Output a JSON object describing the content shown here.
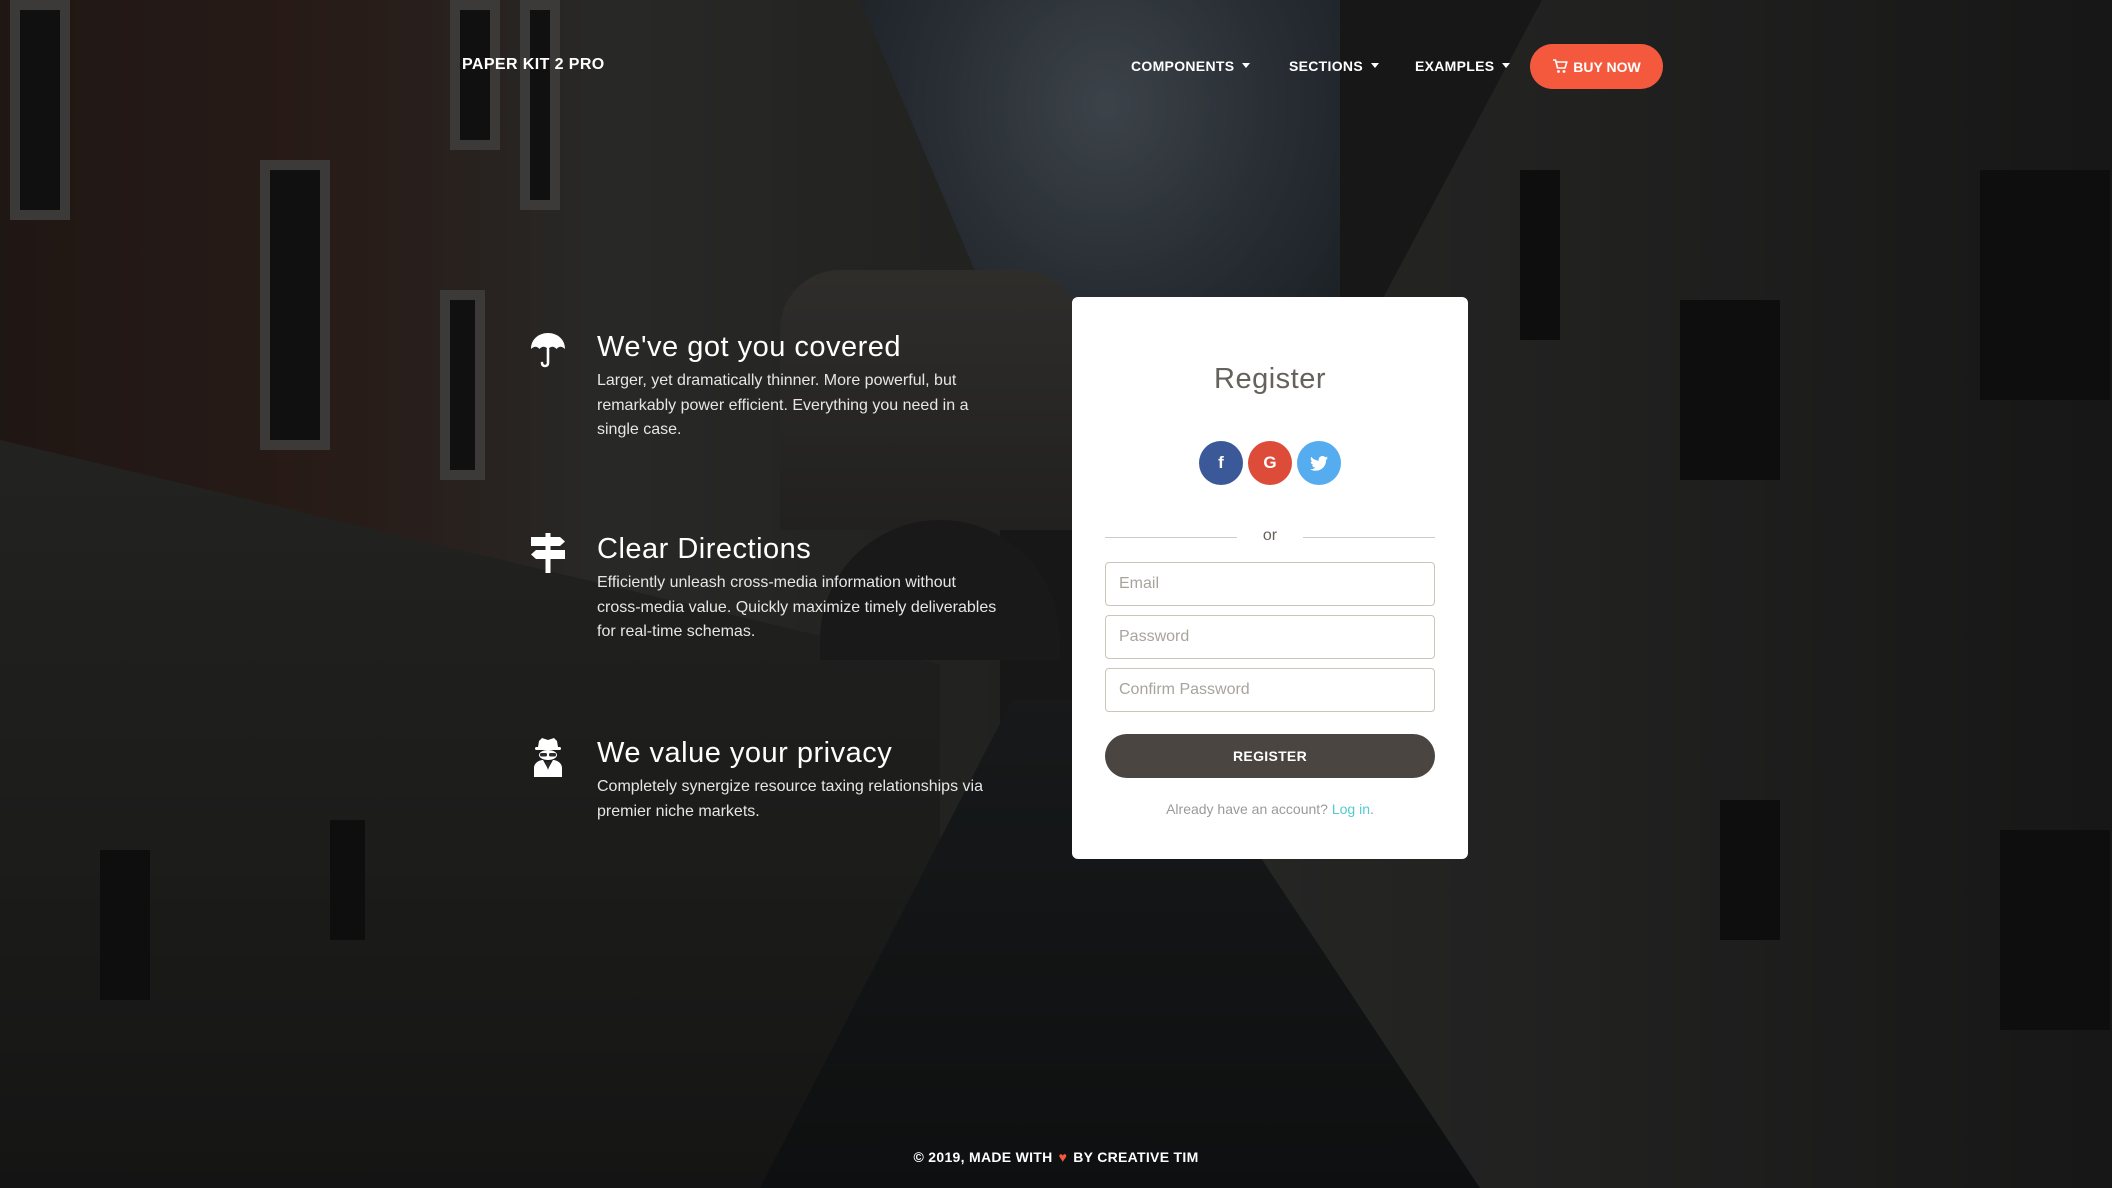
{
  "nav": {
    "brand": "PAPER KIT 2 PRO",
    "items": [
      {
        "label": "COMPONENTS"
      },
      {
        "label": "SECTIONS"
      },
      {
        "label": "EXAMPLES"
      }
    ],
    "buy_label": "BUY NOW",
    "buy_icon": "cart-icon",
    "buy_color": "#f5593d"
  },
  "features": [
    {
      "icon": "umbrella-icon",
      "title": "We've got you covered",
      "text": "Larger, yet dramatically thinner. More powerful, but remarkably power efficient. Everything you need in a single case."
    },
    {
      "icon": "signpost-icon",
      "title": "Clear Directions",
      "text": "Efficiently unleash cross-media information without cross-media value. Quickly maximize timely deliverables for real-time schemas."
    },
    {
      "icon": "spy-icon",
      "title": "We value your privacy",
      "text": "Completely synergize resource taxing relationships via premier niche markets."
    }
  ],
  "register": {
    "title": "Register",
    "social": [
      {
        "icon": "facebook-icon",
        "glyph": "f",
        "color": "#3b5998"
      },
      {
        "icon": "google-icon",
        "glyph": "G",
        "color": "#dd4b39"
      },
      {
        "icon": "twitter-icon",
        "glyph": "t",
        "color": "#55acee"
      }
    ],
    "divider_text": "or",
    "email_placeholder": "Email",
    "password_placeholder": "Password",
    "confirm_placeholder": "Confirm Password",
    "button_label": "REGISTER",
    "login_prompt": "Already have an account?",
    "login_link": "Log in",
    "login_suffix": "."
  },
  "footer": {
    "prefix": "© 2019, MADE WITH",
    "heart": "♥",
    "suffix": "BY CREATIVE TIM"
  }
}
